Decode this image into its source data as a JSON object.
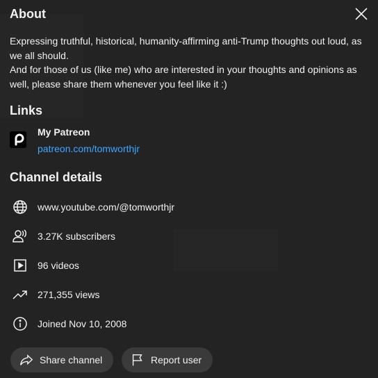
{
  "dialog": {
    "title": "About",
    "close_icon": "close-icon"
  },
  "description": {
    "line1": "Expressing truthful, historical, humanity-affirming anti-Trump thoughts out loud, as we all should.",
    "line2": "And for those of us (like me) who are interested in your thoughts and opinions as well, please share them whenever you feel like it :)"
  },
  "links": {
    "heading": "Links",
    "items": [
      {
        "title": "My Patreon",
        "url": "patreon.com/tomworthjr",
        "icon": "patreon-icon"
      }
    ]
  },
  "details": {
    "heading": "Channel details",
    "items": [
      {
        "icon": "globe-icon",
        "text": "www.youtube.com/@tomworthjr"
      },
      {
        "icon": "subscribers-icon",
        "text": "3.27K subscribers"
      },
      {
        "icon": "video-icon",
        "text": "96 videos"
      },
      {
        "icon": "trending-icon",
        "text": "271,355 views"
      },
      {
        "icon": "info-icon",
        "text": "Joined Nov 10, 2008"
      }
    ]
  },
  "actions": {
    "share_label": "Share channel",
    "report_label": "Report user"
  },
  "colors": {
    "background": "#232323",
    "link": "#3ea6ff",
    "button": "#3a3a3a",
    "text": "#f1f1f1"
  }
}
